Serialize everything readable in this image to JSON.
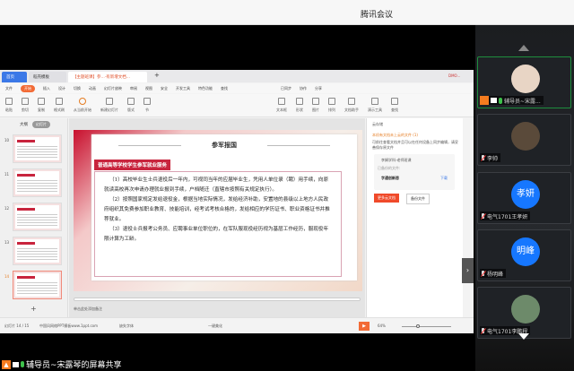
{
  "window": {
    "title": "腾讯会议"
  },
  "wps": {
    "tabs": [
      {
        "label": "首页"
      },
      {
        "label": "稻壳模板"
      },
      {
        "label": "【主题班课】参...·有新增文档..."
      }
    ],
    "account": "DMO...",
    "menu": [
      "文件",
      "开始",
      "插入",
      "设计",
      "切换",
      "动画",
      "幻灯片放映",
      "审阅",
      "视图",
      "安全",
      "开发工具",
      "特色功能",
      "查找"
    ],
    "menu_right": [
      "已同步",
      "协作",
      "分享"
    ],
    "tools": [
      "粘贴",
      "剪切",
      "复制",
      "格式刷",
      "从当前开始",
      "新建幻灯片",
      "版式",
      "节",
      "文本框",
      "形状",
      "图片",
      "排列",
      "文档助手",
      "演示工具",
      "查找",
      "替换"
    ],
    "left_tabs": {
      "outline": "大纲",
      "slides": "幻灯片"
    },
    "thumbs": [
      "10",
      "11",
      "12",
      "13",
      "14"
    ],
    "slide": {
      "title": "参军报国",
      "header": "普通高等学校学生参军就业服务",
      "paragraphs": [
        "（1）高校毕业生士兵退役后一年内，可视同当年的应届毕业生，凭用人单位录（聘）用手续，向原就读高校再次申请办理就业报到手续，户档随迁（直辖市按照有关规定执行）。",
        "（2）按照国家规定发给退役金，根据当地实际情况，发给经济补助，安置地的县级以上地方人民政府组织其免费参加职业教育、技能培训，经考试考核合格的，发给相应的学历证书、职业资格证书并推荐就业。",
        "（3）退役士兵报考公务员、应聘事业单位职位的，在军队服现役经历视为基层工作经历，服现役年限计算为工龄。"
      ]
    },
    "notes_placeholder": "单击此处添加备注",
    "cloud": {
      "title": "云存储",
      "warning": "本机有文档未上云的文件 (1)",
      "desc": "可前往查看文档并且可以在任何设备上同步编辑，请妥善保存原文件",
      "file1": "李娟学科-老师班课",
      "file_sub": "已备份的文件:",
      "file2": "字通创新思",
      "download": "下载",
      "more": "更多云文档",
      "backup": "备份文件"
    },
    "status": {
      "slide": "幻灯片 14 / 15",
      "template": "中国风网络PPT模板www.1ppt.com",
      "font": "缺失字体",
      "beautify": "一键美化",
      "zoom": "64%"
    }
  },
  "share_label": "辅导员~宋露琴的屏幕共享",
  "participants": [
    {
      "name": "辅导员~宋露...",
      "avatar": "",
      "color": "#e8d5c5",
      "muted": false
    },
    {
      "name": "李帅",
      "avatar": "",
      "color": "#5a4a3a",
      "muted": true
    },
    {
      "name": "电气1701王孝妍",
      "avatar": "孝妍",
      "color": "#1677ff",
      "muted": true
    },
    {
      "name": "杨明峰",
      "avatar": "明峰",
      "color": "#1677ff",
      "muted": true
    },
    {
      "name": "电气1701李鹏程",
      "avatar": "",
      "color": "#6d8a6a",
      "muted": true
    }
  ]
}
